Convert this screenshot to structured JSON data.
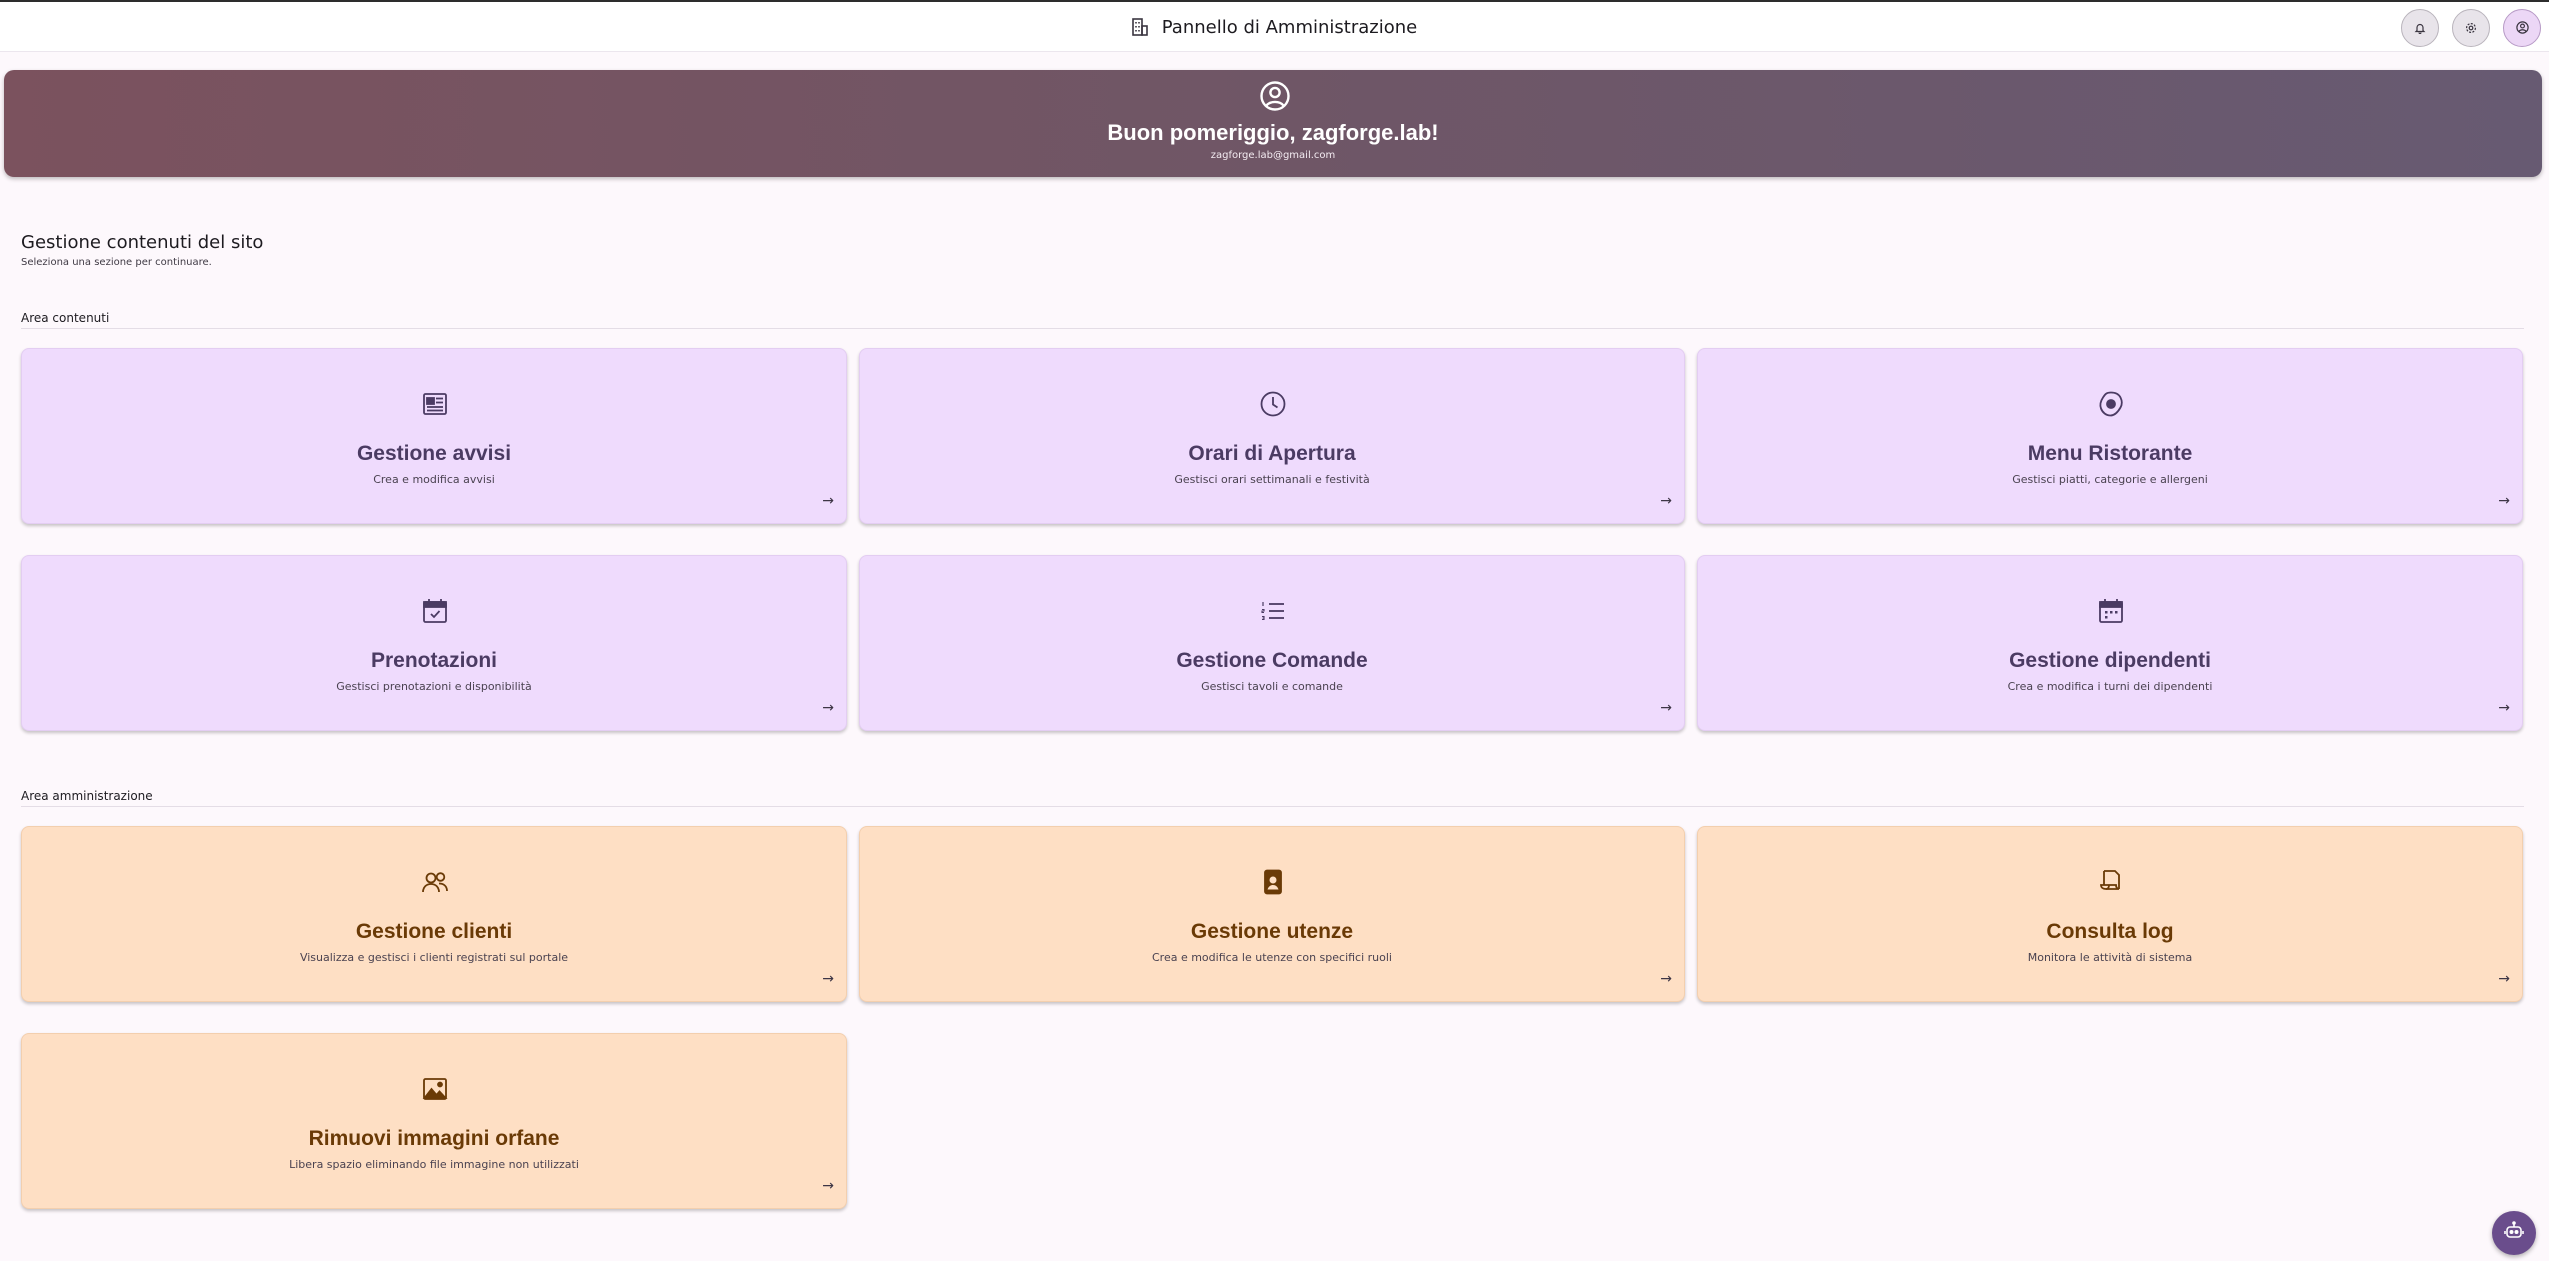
{
  "header": {
    "title": "Pannello di Amministrazione"
  },
  "hero": {
    "greeting": "Buon pomeriggio, zagforge.lab!",
    "email": "zagforge.lab@gmail.com"
  },
  "page": {
    "title": "Gestione contenuti del sito",
    "subtitle": "Seleziona una sezione per continuare."
  },
  "sections": {
    "content": {
      "label": "Area contenuti",
      "cards": [
        {
          "title": "Gestione avvisi",
          "desc": "Crea e modifica avvisi",
          "icon": "newspaper-icon"
        },
        {
          "title": "Orari di Apertura",
          "desc": "Gestisci orari settimanali e festività",
          "icon": "clock-icon"
        },
        {
          "title": "Menu Ristorante",
          "desc": "Gestisci piatti, categorie e allergeni",
          "icon": "egg-icon"
        },
        {
          "title": "Prenotazioni",
          "desc": "Gestisci prenotazioni e disponibilità",
          "icon": "calendar-check-icon"
        },
        {
          "title": "Gestione Comande",
          "desc": "Gestisci tavoli e comande",
          "icon": "numbered-list-icon"
        },
        {
          "title": "Gestione dipendenti",
          "desc": "Crea e modifica i turni dei dipendenti",
          "icon": "calendar-icon"
        }
      ]
    },
    "admin": {
      "label": "Area amministrazione",
      "cards": [
        {
          "title": "Gestione clienti",
          "desc": "Visualizza e gestisci i clienti registrati sul portale",
          "icon": "people-icon"
        },
        {
          "title": "Gestione utenze",
          "desc": "Crea e modifica le utenze con specifici ruoli",
          "icon": "badge-icon"
        },
        {
          "title": "Consulta log",
          "desc": "Monitora le attività di sistema",
          "icon": "scroll-icon"
        },
        {
          "title": "Rimuovi immagini orfane",
          "desc": "Libera spazio eliminando file immagine non utilizzati",
          "icon": "image-icon"
        }
      ]
    }
  },
  "card_arrow": "→",
  "colors": {
    "content_card": "#efdbfd",
    "admin_card": "#fedfc4",
    "hero_start": "#7b525e",
    "hero_end": "#675a72"
  }
}
